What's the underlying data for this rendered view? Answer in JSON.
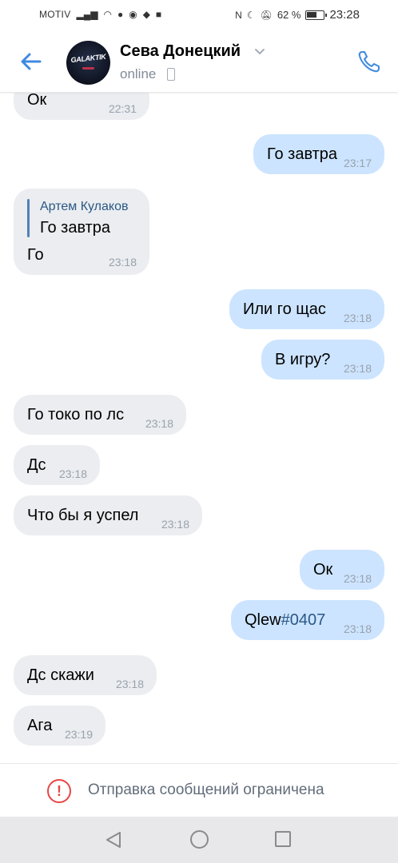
{
  "statusbar": {
    "carrier": "MOTIV",
    "battery_text": "62 %",
    "battery_level": 0.62,
    "time": "23:28"
  },
  "header": {
    "contact_name": "Сева Донецкий",
    "status": "online",
    "avatar_text": "GALAKTIK"
  },
  "messages": [
    {
      "dir": "in",
      "text": "Ок",
      "time": "22:31"
    },
    {
      "dir": "out",
      "text": "Го завтра",
      "time": "23:17"
    },
    {
      "dir": "in",
      "reply_author": "Артем Кулаков",
      "reply_text": "Го завтра",
      "text": "Го",
      "time": "23:18"
    },
    {
      "dir": "out",
      "text": "Или го щас",
      "time": "23:18"
    },
    {
      "dir": "out",
      "text": "В игру?",
      "time": "23:18"
    },
    {
      "dir": "in",
      "text": "Го токо по лс",
      "time": "23:18"
    },
    {
      "dir": "in",
      "text": "Дс",
      "time": "23:18"
    },
    {
      "dir": "in",
      "text": "Что бы я успел",
      "time": "23:18"
    },
    {
      "dir": "out",
      "text": "Ок",
      "time": "23:18"
    },
    {
      "dir": "out",
      "text_prefix": "Qlew",
      "hashtag": "#0407",
      "time": "23:18"
    },
    {
      "dir": "in",
      "text": "Дс скажи",
      "time": "23:18"
    },
    {
      "dir": "in",
      "text": "Ага",
      "time": "23:19"
    }
  ],
  "restriction": {
    "text": "Отправка сообщений ограничена"
  },
  "colors": {
    "accent": "#5181b8",
    "incoming_bubble": "#ebedf0",
    "outgoing_bubble": "#cce4ff",
    "warning": "#e64646"
  },
  "icons": [
    "back-arrow-icon",
    "chevron-down-icon",
    "mobile-icon",
    "phone-icon",
    "warning-icon",
    "nav-back-icon",
    "nav-home-icon",
    "nav-recent-icon"
  ]
}
